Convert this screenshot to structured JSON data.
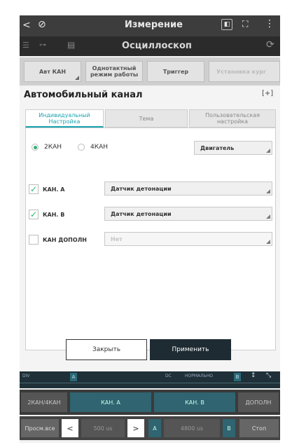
{
  "titlebar": {
    "back": "<",
    "title": "Измерение"
  },
  "subbar": {
    "title": "Осциллоскоп"
  },
  "toolbar": {
    "buttons": [
      {
        "label": "Авт КАН"
      },
      {
        "label": "Однотактный режим работы"
      },
      {
        "label": "Триггер"
      },
      {
        "label": "Установка кург"
      }
    ]
  },
  "dialog": {
    "title": "Автомобильный канал",
    "tabs": [
      {
        "label": "Индивидуальный Настройка"
      },
      {
        "label": "Тема"
      },
      {
        "label": "Пользовательская настройка"
      }
    ],
    "mode": {
      "options": [
        {
          "label": "2КАН"
        },
        {
          "label": "4КАН"
        }
      ],
      "selected": "2КАН",
      "source_value": "Двигатель"
    },
    "channels": [
      {
        "label": "КАН. A",
        "checked": true,
        "value": "Датчик детонации"
      },
      {
        "label": "КАН. B",
        "checked": true,
        "value": "Датчик детонации"
      },
      {
        "label": "КАН ДОПОЛН",
        "checked": false,
        "value": "Нет"
      }
    ],
    "close_label": "Закрыть",
    "apply_label": "Применить"
  },
  "scale": {
    "left_label": "DIV",
    "marker_a": "A",
    "marker_b": "B",
    "mode_label": "DC",
    "status_label": "НОРМАЛЬНО"
  },
  "channel_row": {
    "mode": "2КАН/4КАН",
    "ch_a": "КАН. A",
    "ch_b": "КАН. B",
    "extra": "ДОПОЛН"
  },
  "nav_row": {
    "view_all": "Просм.все",
    "prev": "<",
    "time1": "500 us",
    "next": ">",
    "cursor_a": "A",
    "time2": "4800 us",
    "cursor_b": "B",
    "stop": "Стоп"
  },
  "colors": {
    "accent": "#1aa3b0",
    "check": "#2bb673",
    "apply_bg": "#1e2b33"
  }
}
